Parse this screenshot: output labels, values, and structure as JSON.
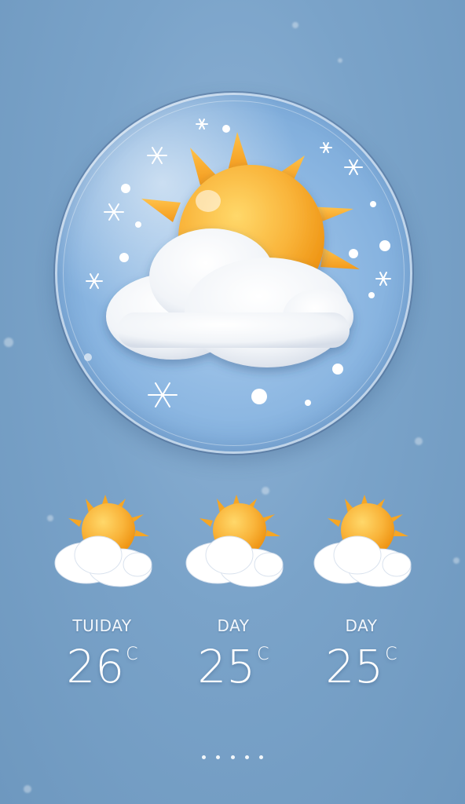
{
  "hero": {
    "icon": "sun-behind-cloud-with-snow-icon"
  },
  "forecast": [
    {
      "day": "TUIDAY",
      "temp": "26",
      "unit": "C",
      "icon": "partly-sunny-icon"
    },
    {
      "day": "DAY",
      "temp": "25",
      "unit": "C",
      "icon": "partly-sunny-icon"
    },
    {
      "day": "DAY",
      "temp": "25",
      "unit": "C",
      "icon": "partly-sunny-icon"
    }
  ],
  "pager": {
    "count": 5
  },
  "colors": {
    "background": "#7aa3c9",
    "sun": "#f7a323",
    "cloud": "#ffffff",
    "text": "#ffffff"
  }
}
